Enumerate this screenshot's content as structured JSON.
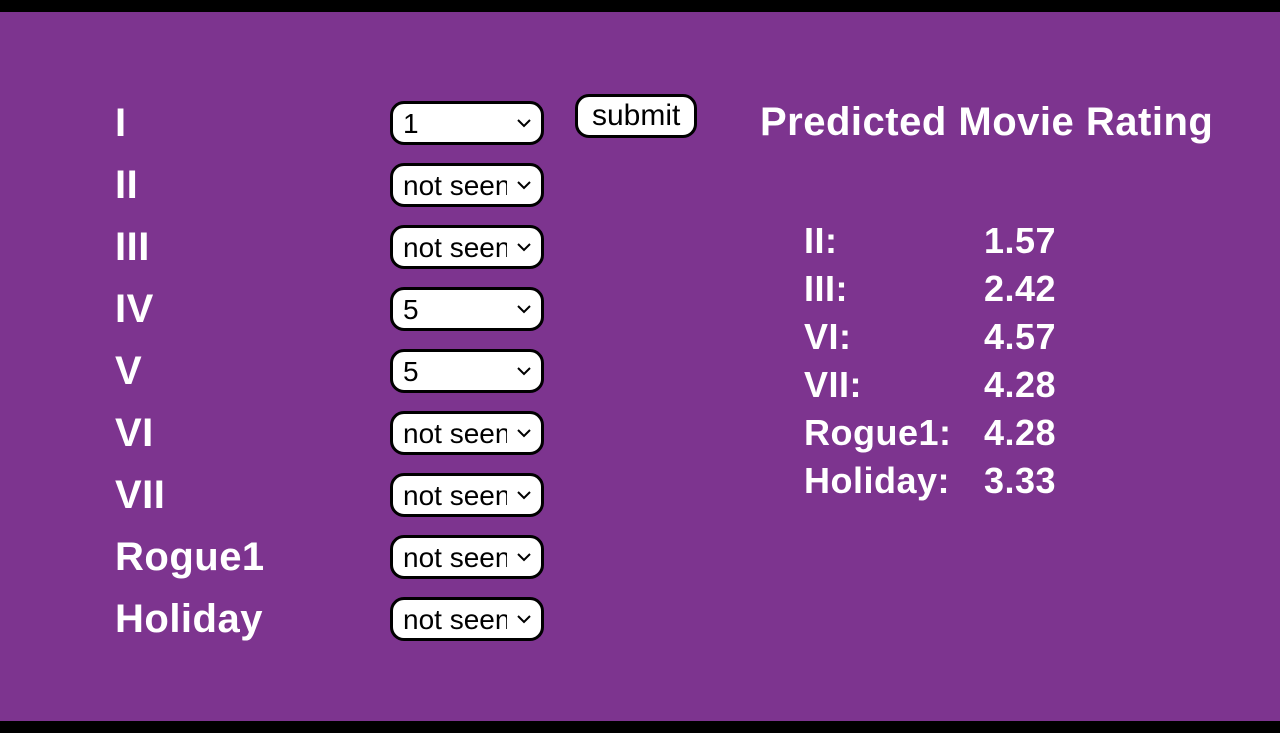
{
  "colors": {
    "background": "#7d348f",
    "text": "#ffffff"
  },
  "form": {
    "submit_label": "submit",
    "movies": [
      {
        "label": "I",
        "selected": "1"
      },
      {
        "label": "II",
        "selected": "not seen"
      },
      {
        "label": "III",
        "selected": "not seen"
      },
      {
        "label": "IV",
        "selected": "5"
      },
      {
        "label": "V",
        "selected": "5"
      },
      {
        "label": "VI",
        "selected": "not seen"
      },
      {
        "label": "VII",
        "selected": "not seen"
      },
      {
        "label": "Rogue1",
        "selected": "not seen"
      },
      {
        "label": "Holiday",
        "selected": "not seen"
      }
    ]
  },
  "results": {
    "title": "Predicted Movie Rating",
    "predictions": [
      {
        "label": "II:",
        "value": "1.57"
      },
      {
        "label": "III:",
        "value": "2.42"
      },
      {
        "label": "VI:",
        "value": "4.57"
      },
      {
        "label": "VII:",
        "value": "4.28"
      },
      {
        "label": "Rogue1:",
        "value": "4.28"
      },
      {
        "label": "Holiday:",
        "value": "3.33"
      }
    ]
  }
}
